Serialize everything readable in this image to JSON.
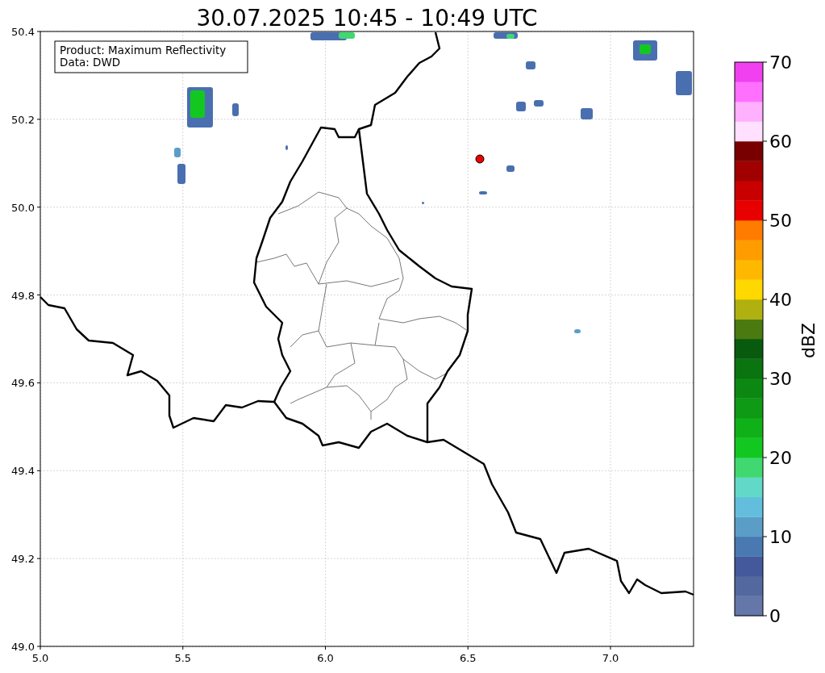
{
  "title": "30.07.2025 10:45 - 10:49 UTC",
  "legend": [
    "Product: Maximum Reflectivity",
    "Data: DWD"
  ],
  "x_ticks": [
    "5.0",
    "5.5",
    "6.0",
    "6.5",
    "7.0"
  ],
  "y_ticks": [
    "50.4",
    "50.2",
    "50.0",
    "49.8",
    "49.6",
    "49.4",
    "49.2",
    "49.0"
  ],
  "colorbar": {
    "label": "dBZ",
    "ticks": [
      "70",
      "60",
      "50",
      "40",
      "30",
      "20",
      "10",
      "0"
    ],
    "segments": [
      {
        "color": "#6577a8"
      },
      {
        "color": "#5468a0"
      },
      {
        "color": "#44599c"
      },
      {
        "color": "#4a78b0"
      },
      {
        "color": "#5a9ec8"
      },
      {
        "color": "#62bedc"
      },
      {
        "color": "#62d8c8"
      },
      {
        "color": "#40d870"
      },
      {
        "color": "#12c820"
      },
      {
        "color": "#10b018"
      },
      {
        "color": "#0e9a14"
      },
      {
        "color": "#0c8812"
      },
      {
        "color": "#0a7410"
      },
      {
        "color": "#085a0e"
      },
      {
        "color": "#4a7a10"
      },
      {
        "color": "#b0b010"
      },
      {
        "color": "#ffd800"
      },
      {
        "color": "#ffb800"
      },
      {
        "color": "#ff9c00"
      },
      {
        "color": "#ff7c00"
      },
      {
        "color": "#e80000"
      },
      {
        "color": "#c80000"
      },
      {
        "color": "#a00000"
      },
      {
        "color": "#780000"
      },
      {
        "color": "#ffe0ff"
      },
      {
        "color": "#ffb0ff"
      },
      {
        "color": "#ff70ff"
      },
      {
        "color": "#f040f0"
      }
    ]
  }
}
